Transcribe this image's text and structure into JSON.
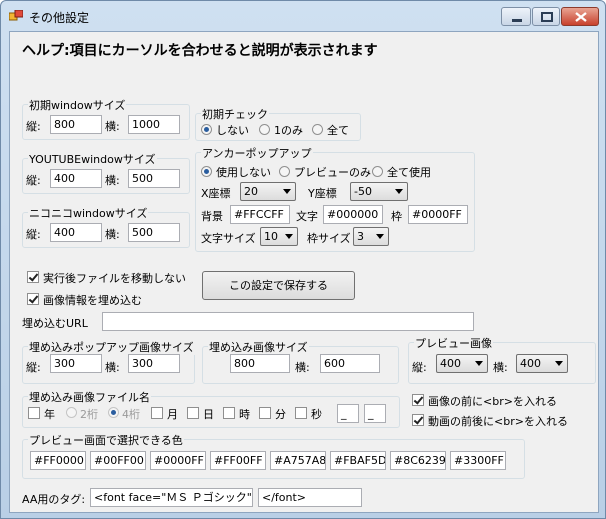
{
  "window": {
    "title": "その他設定",
    "controls": [
      "minimize-icon",
      "maximize-icon",
      "close-icon"
    ]
  },
  "help_text": "ヘルプ:項目にカーソルを合わせると説明が表示されます",
  "initial_window": {
    "label": "初期windowサイズ",
    "height_label": "縦:",
    "height": "800",
    "width_label": "横:",
    "width": "1000"
  },
  "youtube_window": {
    "label": "YOUTUBEwindowサイズ",
    "height_label": "縦:",
    "height": "400",
    "width_label": "横:",
    "width": "500"
  },
  "niconico_window": {
    "label": "ニコニコwindowサイズ",
    "height_label": "縦:",
    "height": "400",
    "width_label": "横:",
    "width": "500"
  },
  "initial_check": {
    "label": "初期チェック",
    "options": [
      "しない",
      "1のみ",
      "全て"
    ],
    "selected": 0
  },
  "anchor_popup": {
    "label": "アンカーポップアップ",
    "options": [
      "使用しない",
      "プレビューのみ",
      "全て使用"
    ],
    "selected": 0,
    "x_label": "X座標",
    "x_value": "20",
    "y_label": "Y座標",
    "y_value": "-50",
    "bg_label": "背景",
    "bg_value": "#FFCCFF",
    "text_label": "文字",
    "text_value": "#000000",
    "border_label": "枠",
    "border_value": "#0000FF",
    "font_size_label": "文字サイズ",
    "font_size_value": "10",
    "border_size_label": "枠サイズ",
    "border_size_value": "3"
  },
  "options": {
    "no_move_label": "実行後ファイルを移動しない",
    "no_move_checked": true,
    "embed_info_label": "画像情報を埋め込む",
    "embed_info_checked": true
  },
  "save_button": "この設定で保存する",
  "embed_url": {
    "label": "埋め込むURL",
    "value": ""
  },
  "embed_popup": {
    "label": "埋め込みポップアップ画像サイズ",
    "height_label": "縦:",
    "height": "300",
    "width_label": "横:",
    "width": "300"
  },
  "embed_image": {
    "label": "埋め込み画像サイズ",
    "height_label": "縦:",
    "height": "800",
    "width_label": "横:",
    "width": "600"
  },
  "preview_image": {
    "label": "プレビュー画像",
    "height_label": "縦:",
    "height": "400",
    "width_label": "横:",
    "width": "400"
  },
  "embed_filename": {
    "label": "埋め込み画像ファイル名",
    "year": "年",
    "two_digit": "2桁",
    "four_digit": "4桁",
    "month": "月",
    "day": "日",
    "hour": "時",
    "minute": "分",
    "second": "秒",
    "sep1": "_",
    "sep2": "_"
  },
  "br_options": {
    "before_image": "画像の前に<br>を入れる",
    "before_image_checked": true,
    "around_video": "動画の前後に<br>を入れる",
    "around_video_checked": true
  },
  "preview_colors": {
    "label": "プレビュー画面で選択できる色",
    "colors": [
      "#FF0000",
      "#00FF00",
      "#0000FF",
      "#FF00FF",
      "#A757A8",
      "#FBAF5D",
      "#8C6239",
      "#3300FF"
    ]
  },
  "aa_tag": {
    "label": "AA用のタグ:",
    "open_tag": "<font face=\"ＭＳ Ｐゴシック\">",
    "close_tag": "</font>"
  }
}
